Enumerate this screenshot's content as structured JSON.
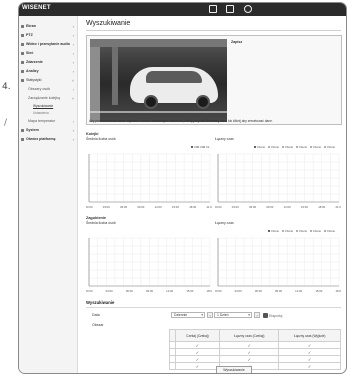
{
  "margin": {
    "number": "4.",
    "slash": "/"
  },
  "app": {
    "logo": "WISENET",
    "page_title": "Wyszukiwanie"
  },
  "sidebar": {
    "items": [
      {
        "label": "Ekran"
      },
      {
        "label": "PTZ"
      },
      {
        "label": "Wideo i przesyłanie audio"
      },
      {
        "label": "Sieć"
      },
      {
        "label": "Zdarzenie"
      },
      {
        "label": "Analizy"
      },
      {
        "label": "Statystyki"
      },
      {
        "label": "Obszary osób"
      },
      {
        "label": "Zarządzanie kolejką"
      },
      {
        "label": "Wyszukiwanie"
      },
      {
        "label": "Ustawienia"
      },
      {
        "label": "Mapa temperatur"
      },
      {
        "label": "System"
      },
      {
        "label": "Otwórz platformę"
      }
    ]
  },
  "video": {
    "zone_label": "Zapisz",
    "caption": "Aby przeanalizować dane zapisane z nowo ustawionych obszarów, kliknij przycisk Zrestartuj dane lub kliknij aby zresetować dane."
  },
  "sections": {
    "queue_label": "Kolejki",
    "queue_left_sub": "Średnia liczba osób",
    "queue_right_sub": "Łączny czas",
    "wait_label": "Zagubienie",
    "wait_left_sub": "Średnia liczba osób",
    "wait_right_sub": "Łączny czas"
  },
  "chart_legends": {
    "top_left": [
      "Ob",
      "O1",
      "O2"
    ],
    "top_right": [
      "Obszar",
      "Obszar",
      "Obszar",
      "Obszar",
      "Obszar",
      "Obszar"
    ],
    "bottom_right": [
      "Obszar",
      "Obszar",
      "Obszar",
      "Obszar",
      "Obszar"
    ]
  },
  "chart_ticks": {
    "top": [
      "00:00",
      "03:00",
      "06:00",
      "09:00",
      "12:00",
      "15:00",
      "18:00",
      "21:00"
    ],
    "bottom_left": [
      "00:00",
      "03:00",
      "06:00",
      "09:00",
      "12:00",
      "15:00",
      "18:00"
    ],
    "bottom_right": [
      "00:00",
      "03:00",
      "06:00",
      "09:00",
      "12:00",
      "15:00",
      "18:00"
    ]
  },
  "results": {
    "title": "Wyszukiwanie",
    "period_label": "Data",
    "period_value": "Dziennie",
    "date_value": "1 Dzień",
    "export_label": "Eksportuj",
    "area_label": "Obszar",
    "columns": [
      "",
      "Czekaj (Czekaj)",
      "Łączny czas (Czekaj)",
      "Łączny czas (Wyjście)"
    ],
    "rows": [
      {
        "name": "",
        "checks": [
          "✓",
          "✓",
          "✓"
        ]
      },
      {
        "name": "",
        "checks": [
          "✓",
          "✓",
          "✓"
        ]
      },
      {
        "name": "",
        "checks": [
          "✓",
          "✓",
          "✓"
        ]
      },
      {
        "name": "",
        "checks": [
          "✓",
          "✓",
          "✓"
        ]
      }
    ],
    "apply_label": "Wyszukiwanie"
  },
  "colors": {
    "topbar": "#2b2b2b",
    "sidebar": "#f4f4f4",
    "gridline": "#e8e8e8"
  }
}
